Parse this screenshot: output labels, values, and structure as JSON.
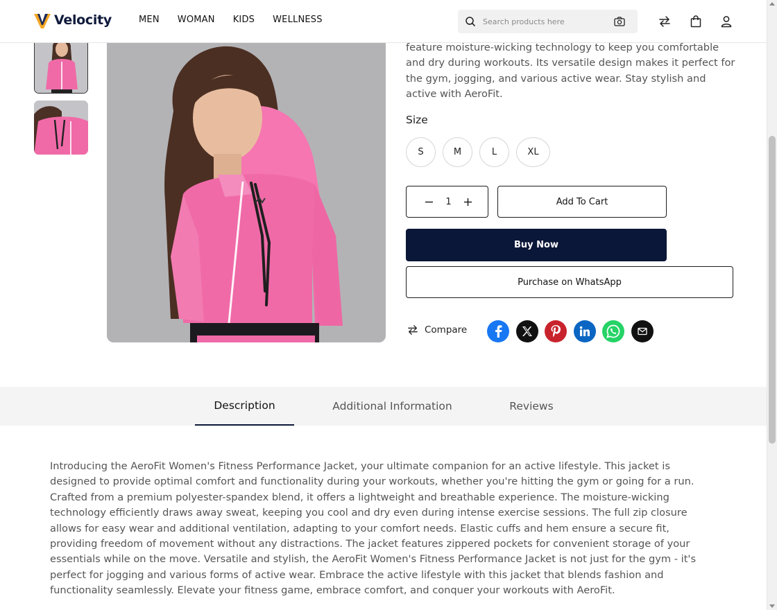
{
  "brand": {
    "name": "Velocity",
    "logo_colors": [
      "#f5a623",
      "#1a2a5a"
    ]
  },
  "nav": {
    "items": [
      "MEN",
      "WOMAN",
      "KIDS",
      "WELLNESS"
    ]
  },
  "search": {
    "placeholder": "Search products here"
  },
  "header_icons": [
    "compare-arrows-icon",
    "shopping-bag-icon",
    "user-icon"
  ],
  "product": {
    "short_description": "feature moisture-wicking technology to keep you comfortable and dry during workouts. Its versatile design makes it perfect for the gym, jogging, and various active wear. Stay stylish and active with AeroFit.",
    "size_label": "Size",
    "sizes": [
      "S",
      "M",
      "L",
      "XL"
    ],
    "quantity": "1",
    "add_to_cart": "Add To Cart",
    "buy_now": "Buy Now",
    "whatsapp": "Purchase on WhatsApp",
    "compare": "Compare",
    "share": [
      "facebook-icon",
      "x-twitter-icon",
      "pinterest-icon",
      "linkedin-icon",
      "whatsapp-icon",
      "email-icon"
    ]
  },
  "tabs": [
    {
      "label": "Description",
      "active": true
    },
    {
      "label": "Additional Information",
      "active": false
    },
    {
      "label": "Reviews",
      "active": false
    }
  ],
  "description": "Introducing the AeroFit Women's Fitness Performance Jacket, your ultimate companion for an active lifestyle. This jacket is designed to provide optimal comfort and functionality during your workouts, whether you're hitting the gym or going for a run. Crafted from a premium polyester-spandex blend, it offers a lightweight and breathable experience. The moisture-wicking technology efficiently draws away sweat, keeping you cool and dry even during intense exercise sessions. The full zip closure allows for easy wear and additional ventilation, adapting to your comfort needs. Elastic cuffs and hem ensure a secure fit, providing freedom of movement without any distractions. The jacket features zippered pockets for convenient storage of your essentials while on the move. Versatile and stylish, the AeroFit Women's Fitness Performance Jacket is not just for the gym - it's perfect for jogging and various forms of active wear. Embrace the active lifestyle with this jacket that blends fashion and functionality seamlessly. Elevate your fitness game, embrace comfort, and conquer your workouts with AeroFit.",
  "colors": {
    "navy": "#0b1738",
    "jacket_pink": "#f06aa8",
    "facebook": "#1877f2",
    "x": "#111111",
    "pinterest": "#c8232c",
    "linkedin": "#0a66c2",
    "whatsapp": "#25d366",
    "email": "#111111"
  }
}
